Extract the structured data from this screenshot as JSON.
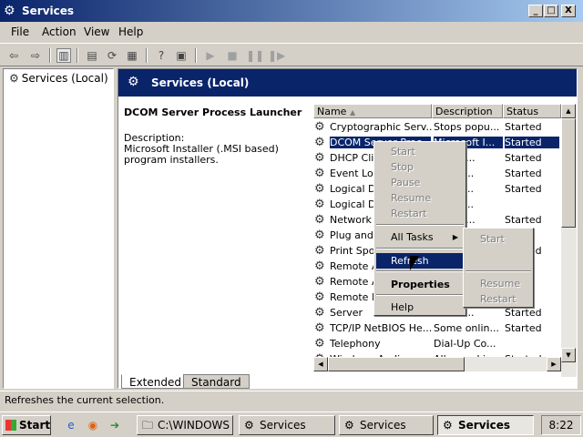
{
  "window": {
    "title": "Services",
    "min_label": "_",
    "max_label": "□",
    "close_label": "X"
  },
  "menu": [
    "File",
    "Action",
    "View",
    "Help"
  ],
  "tree": {
    "root_label": "Services (Local)"
  },
  "right_header": "Services (Local)",
  "details": {
    "service_name": "DCOM Server Process Launcher",
    "description_label": "Description:",
    "description_text": "Microsoft Installer (.MSI based) program installers."
  },
  "columns": [
    "Name",
    "Description",
    "Status"
  ],
  "rows": [
    {
      "name": "Cryptographic Serv...",
      "desc": "Stops popu...",
      "status": "Started"
    },
    {
      "name": "DCOM Server Proc...",
      "desc": "Microsoft I...",
      "status": "Started",
      "selected": true
    },
    {
      "name": "DHCP Client",
      "desc": "...d for...",
      "status": "Started"
    },
    {
      "name": "Event Log",
      "desc": "...ou c...",
      "status": "Started"
    },
    {
      "name": "Logical Disk...",
      "desc": "...s ne...",
      "status": "Started"
    },
    {
      "name": "Logical Disk...",
      "desc": "...s ne...",
      "status": ""
    },
    {
      "name": "Network",
      "desc": "...d for...",
      "status": "Started"
    },
    {
      "name": "Plug and Play",
      "desc": "",
      "status": ""
    },
    {
      "name": "Print Spooler",
      "desc": "...fu...",
      "status": "Started"
    },
    {
      "name": "Remote A...",
      "desc": "... Co...",
      "status": ""
    },
    {
      "name": "Remote A...",
      "desc": "",
      "status": ""
    },
    {
      "name": "Remote P...",
      "desc": "",
      "status": ""
    },
    {
      "name": "Server",
      "desc": "...s PC...",
      "status": "Started"
    },
    {
      "name": "TCP/IP NetBIOS He...",
      "desc": "Some onlin...",
      "status": "Started"
    },
    {
      "name": "Telephony",
      "desc": "Dial-Up Co...",
      "status": ""
    },
    {
      "name": "Windows Audio",
      "desc": "All sound in...",
      "status": "Started"
    }
  ],
  "context_menu": {
    "items": [
      "Start",
      "Stop",
      "Pause",
      "Resume",
      "Restart",
      "All Tasks",
      "Refresh",
      "Properties",
      "Help"
    ]
  },
  "submenu": {
    "items": [
      "Start",
      "Resume",
      "Restart"
    ]
  },
  "tabs": [
    "Extended",
    "Standard"
  ],
  "status_text": "Refreshes the current selection.",
  "taskbar": {
    "start_label": "Start",
    "tasks": [
      "C:\\WINDOWS",
      "Services",
      "Services",
      "Services"
    ],
    "clock": "8:22"
  }
}
